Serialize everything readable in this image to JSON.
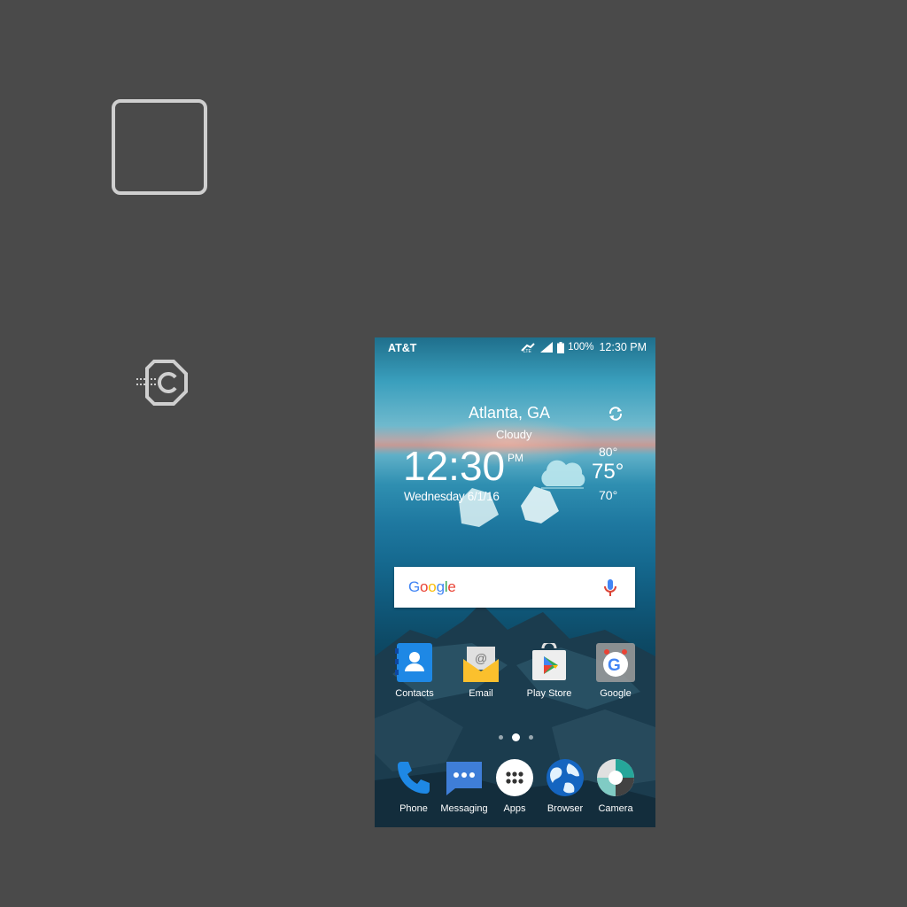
{
  "status": {
    "carrier": "AT&T",
    "battery": "100%",
    "time": "12:30 PM"
  },
  "weather": {
    "city": "Atlanta, GA",
    "condition": "Cloudy",
    "time": "12:30",
    "ampm": "PM",
    "date": "Wednesday 6/1/16",
    "high": "80°",
    "current": "75°",
    "low": "70°"
  },
  "search": {
    "logo": "Google"
  },
  "apps_row": [
    {
      "label": "Contacts",
      "icon": "contacts-icon"
    },
    {
      "label": "Email",
      "icon": "email-icon"
    },
    {
      "label": "Play Store",
      "icon": "play-store-icon"
    },
    {
      "label": "Google",
      "icon": "google-folder-icon"
    }
  ],
  "dock": [
    {
      "label": "Phone",
      "icon": "phone-icon"
    },
    {
      "label": "Messaging",
      "icon": "messaging-icon"
    },
    {
      "label": "Apps",
      "icon": "apps-icon"
    },
    {
      "label": "Browser",
      "icon": "browser-icon"
    },
    {
      "label": "Camera",
      "icon": "camera-icon"
    }
  ],
  "page_indicator": {
    "pages": 3,
    "current": 2
  },
  "colors": {
    "background": "#4a4a4a",
    "contacts": "#1e88e5",
    "email": "#fbc02d",
    "phone": "#1e88e5",
    "messaging": "#3f7ed8",
    "browser": "#1565c0",
    "camera": "#26a69a"
  }
}
